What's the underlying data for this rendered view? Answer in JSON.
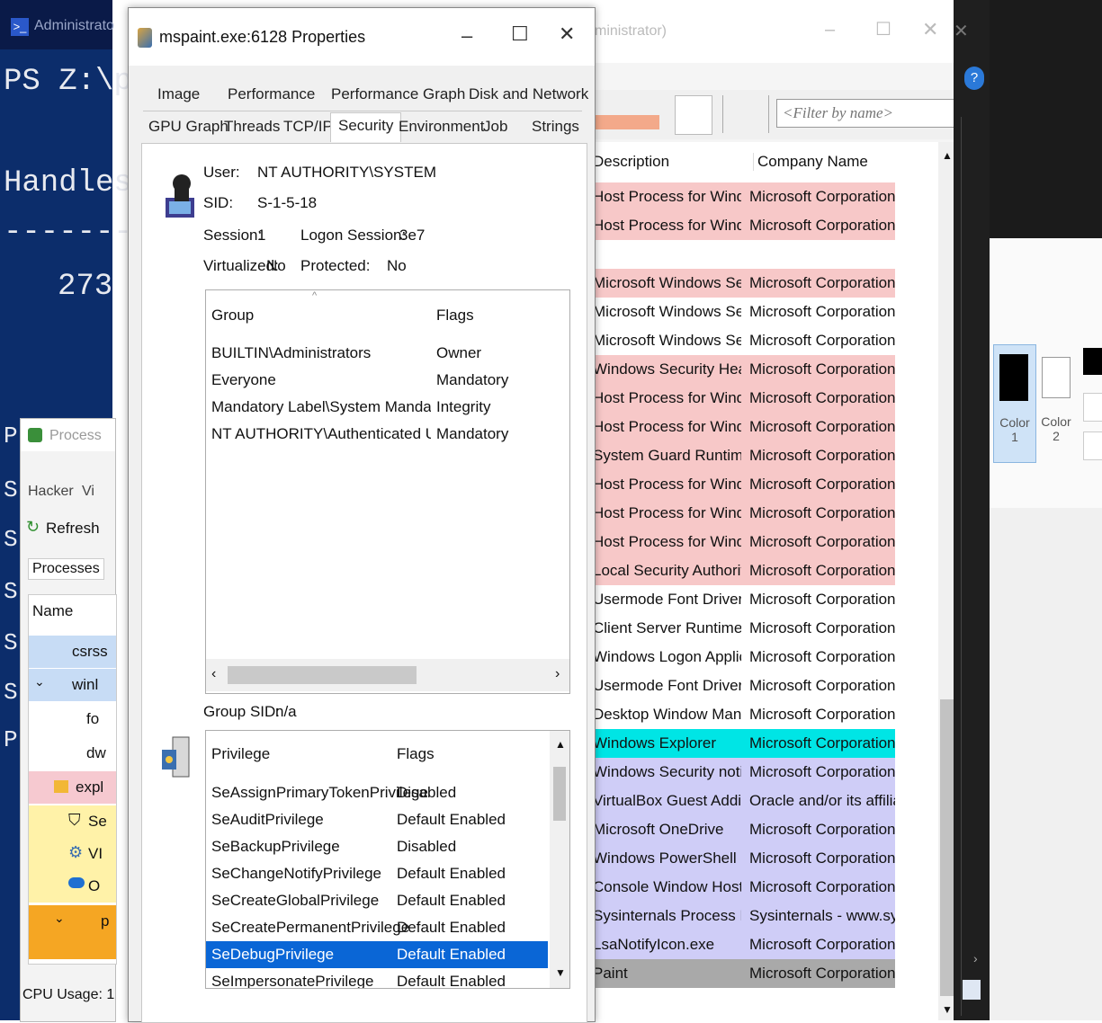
{
  "powershell": {
    "title": "Administrato",
    "prompt_line": "PS Z:\\pa",
    "handles_label": "Handles",
    "separator": "-------",
    "value": "273",
    "line_letters": [
      "P",
      "S",
      "S",
      "S",
      "S",
      "S",
      "P"
    ]
  },
  "process_hacker": {
    "title": "Process",
    "menu": [
      "Hacker",
      "Vi"
    ],
    "refresh_label": "Refresh",
    "tab_processes": "Processes",
    "col_name": "Name",
    "rows": [
      "csrss",
      "winl",
      "fo",
      "dw",
      "expl",
      "Se",
      "VI",
      "O",
      "p"
    ],
    "status": "CPU Usage: 1"
  },
  "dialog": {
    "title": "mspaint.exe:6128 Properties",
    "tabs_row1": [
      "Image",
      "Performance",
      "Performance Graph",
      "Disk and Network"
    ],
    "tabs_row2": [
      "GPU Graph",
      "Threads",
      "TCP/IP",
      "Security",
      "Environment",
      "Job",
      "Strings"
    ],
    "active_tab": "Security",
    "user_label": "User:",
    "user_value": "NT AUTHORITY\\SYSTEM",
    "sid_label": "SID:",
    "sid_value": "S-1-5-18",
    "session_label": "Session:",
    "session_value": "1",
    "logon_label": "Logon Session:",
    "logon_value": "3e7",
    "virtualized_label": "Virtualized:",
    "virtualized_value": "No",
    "protected_label": "Protected:",
    "protected_value": "No",
    "groups_header": {
      "group": "Group",
      "flags": "Flags"
    },
    "groups": [
      {
        "group": "BUILTIN\\Administrators",
        "flags": "Owner"
      },
      {
        "group": "Everyone",
        "flags": "Mandatory"
      },
      {
        "group": "Mandatory Label\\System Mandatory Level",
        "flags": "Integrity"
      },
      {
        "group": "NT AUTHORITY\\Authenticated Users",
        "flags": "Mandatory"
      }
    ],
    "group_sid_label": "Group SID:",
    "group_sid_value": "n/a",
    "priv_header": {
      "privilege": "Privilege",
      "flags": "Flags"
    },
    "privileges": [
      {
        "privilege": "SeAssignPrimaryTokenPrivilege",
        "flags": "Disabled"
      },
      {
        "privilege": "SeAuditPrivilege",
        "flags": "Default Enabled"
      },
      {
        "privilege": "SeBackupPrivilege",
        "flags": "Disabled"
      },
      {
        "privilege": "SeChangeNotifyPrivilege",
        "flags": "Default Enabled"
      },
      {
        "privilege": "SeCreateGlobalPrivilege",
        "flags": "Default Enabled"
      },
      {
        "privilege": "SeCreatePermanentPrivilege",
        "flags": "Default Enabled"
      },
      {
        "privilege": "SeDebugPrivilege",
        "flags": "Default Enabled"
      },
      {
        "privilege": "SeImpersonatePrivilege",
        "flags": "Default Enabled"
      }
    ],
    "selected_privilege": "SeDebugPrivilege"
  },
  "process_explorer": {
    "title_fragment": "ministrator)",
    "filter_placeholder": "<Filter by name>",
    "col_description": "Description",
    "col_company": "Company Name",
    "rows": [
      {
        "desc": "Host Process for Windows S...",
        "comp": "Microsoft Corporation",
        "color": "#f7c8c8"
      },
      {
        "desc": "Host Process for Windows S...",
        "comp": "Microsoft Corporation",
        "color": "#f7c8c8"
      },
      {
        "desc": "",
        "comp": "",
        "color": "#ffffff"
      },
      {
        "desc": "Microsoft Windows Search I...",
        "comp": "Microsoft Corporation",
        "color": "#f7c8c8"
      },
      {
        "desc": "Microsoft Windows Search P...",
        "comp": "Microsoft Corporation",
        "color": "#ffffff"
      },
      {
        "desc": "Microsoft Windows Search F...",
        "comp": "Microsoft Corporation",
        "color": "#ffffff"
      },
      {
        "desc": "Windows Security Health Se...",
        "comp": "Microsoft Corporation",
        "color": "#f7c8c8"
      },
      {
        "desc": "Host Process for Windows S...",
        "comp": "Microsoft Corporation",
        "color": "#f7c8c8"
      },
      {
        "desc": "Host Process for Windows S...",
        "comp": "Microsoft Corporation",
        "color": "#f7c8c8"
      },
      {
        "desc": "System Guard Runtime Monit...",
        "comp": "Microsoft Corporation",
        "color": "#f7c8c8"
      },
      {
        "desc": "Host Process for Windows S...",
        "comp": "Microsoft Corporation",
        "color": "#f7c8c8"
      },
      {
        "desc": "Host Process for Windows S...",
        "comp": "Microsoft Corporation",
        "color": "#f7c8c8"
      },
      {
        "desc": "Host Process for Windows S...",
        "comp": "Microsoft Corporation",
        "color": "#f7c8c8"
      },
      {
        "desc": "Local Security Authority Proc...",
        "comp": "Microsoft Corporation",
        "color": "#f7c8c8"
      },
      {
        "desc": "Usermode Font Driver Host",
        "comp": "Microsoft Corporation",
        "color": "#ffffff"
      },
      {
        "desc": "Client Server Runtime Process",
        "comp": "Microsoft Corporation",
        "color": "#ffffff"
      },
      {
        "desc": "Windows Logon Application",
        "comp": "Microsoft Corporation",
        "color": "#ffffff"
      },
      {
        "desc": "Usermode Font Driver Host",
        "comp": "Microsoft Corporation",
        "color": "#ffffff"
      },
      {
        "desc": "Desktop Window Manager",
        "comp": "Microsoft Corporation",
        "color": "#ffffff"
      },
      {
        "desc": "Windows Explorer",
        "comp": "Microsoft Corporation",
        "color": "#00e5e5"
      },
      {
        "desc": "Windows Security notificatio...",
        "comp": "Microsoft Corporation",
        "color": "#cfcdf7"
      },
      {
        "desc": "VirtualBox Guest Additions Tr...",
        "comp": "Oracle and/or its affiliates",
        "color": "#cfcdf7"
      },
      {
        "desc": "Microsoft OneDrive",
        "comp": "Microsoft Corporation",
        "color": "#cfcdf7"
      },
      {
        "desc": "Windows PowerShell",
        "comp": "Microsoft Corporation",
        "color": "#cfcdf7"
      },
      {
        "desc": "Console Window Host",
        "comp": "Microsoft Corporation",
        "color": "#cfcdf7"
      },
      {
        "desc": "Sysinternals Process Explorer",
        "comp": "Sysinternals - www.sysinter...",
        "color": "#cfcdf7"
      },
      {
        "desc": "LsaNotifyIcon.exe",
        "comp": "Microsoft Corporation",
        "color": "#cfcdf7"
      },
      {
        "desc": "Paint",
        "comp": "Microsoft Corporation",
        "color": "#a9a9a9"
      }
    ]
  },
  "paint": {
    "color1_label": "Color 1",
    "color2_label": "Color 2"
  }
}
